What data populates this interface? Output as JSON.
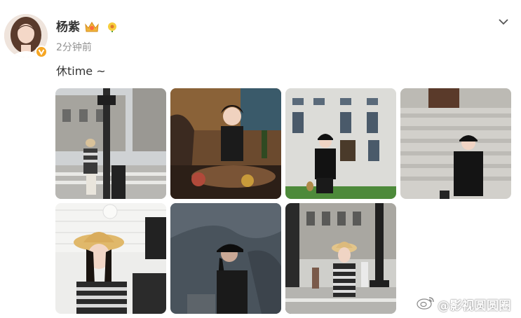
{
  "post": {
    "author": "杨紫",
    "timestamp": "2分钟前",
    "text": "休time ~"
  },
  "icons": {
    "avatar": "user-avatar",
    "verified": "verified-badge-icon",
    "badge1": "crown-badge-icon",
    "badge2": "flower-badge-icon",
    "menu": "chevron-down-icon",
    "watermark": "weibo-logo-icon"
  },
  "photos": [
    "street-crosswalk-photo",
    "restaurant-table-photo",
    "building-front-photo",
    "stone-steps-photo",
    "sunhat-cafe-photo",
    "shadow-wall-photo",
    "city-street-photo"
  ],
  "watermark": {
    "text": "@影视圆圆圈"
  },
  "colors": {
    "username": "#333333",
    "timestamp": "#939393",
    "verified": "#f6a623"
  }
}
